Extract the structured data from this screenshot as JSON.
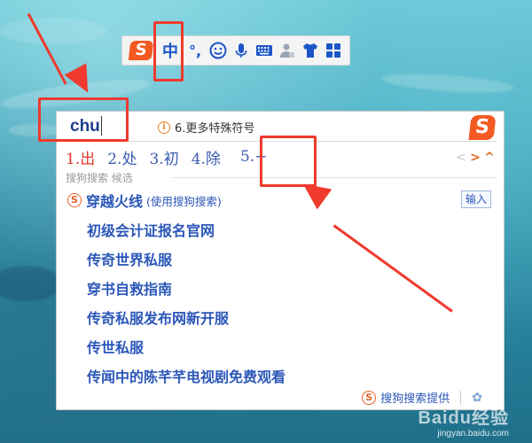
{
  "toolbar": {
    "logo_letter": "S",
    "lang_mode": "中",
    "punct_mode": "°,",
    "icons": [
      "smiley-icon",
      "microphone-icon",
      "keyboard-icon",
      "user-skin-icon",
      "tshirt-icon",
      "grid-tools-icon"
    ]
  },
  "candidate_window": {
    "pinyin": "chu",
    "hint_icon": "i",
    "hint_text": "6.更多特殊符号",
    "logo_letter": "S",
    "candidates": [
      {
        "label": "1.出"
      },
      {
        "label": "2.处"
      },
      {
        "label": "3.初"
      },
      {
        "label": "4.除"
      },
      {
        "label": "5.÷"
      }
    ],
    "pager": {
      "prev": "<",
      "next": ">",
      "collapse": "^"
    },
    "section_label": "搜狗搜索 候选",
    "search": {
      "icon_letter": "S",
      "title": "穿越火线",
      "subtitle": "(使用搜狗搜索)",
      "input_button": "输入"
    },
    "results": [
      "初级会计证报名官网",
      "传奇世界私服",
      "穿书自救指南",
      "传奇私服发布网新开服",
      "传世私服",
      "传闻中的陈芊芊电视剧免费观看"
    ],
    "footer": {
      "icon_letter": "S",
      "label": "搜狗搜索提供",
      "settings_icon": "gear-icon"
    }
  },
  "watermark": {
    "brand": "Baidu经验",
    "url": "jingyan.baidu.com"
  },
  "colors": {
    "accent_red": "#f03a2e",
    "sogou_orange": "#f25a22",
    "link_blue": "#2b57b8",
    "first_candidate": "#e03a2a"
  }
}
